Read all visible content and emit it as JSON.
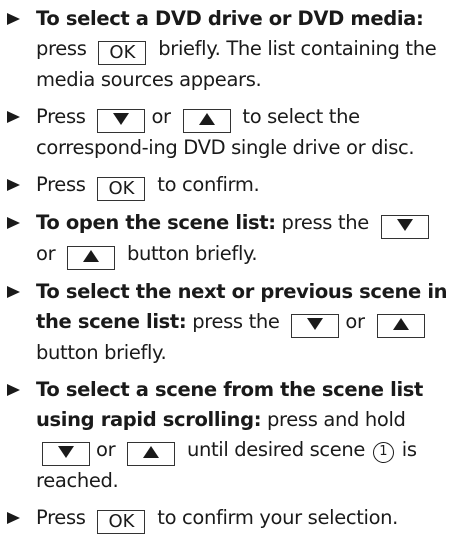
{
  "steps": [
    {
      "bold": "To select a DVD drive or DVD media:",
      "text_a": " press",
      "key": "OK",
      "text_b": " briefly. The list containing the media sources appears."
    },
    {
      "text_a": "Press",
      "text_or": "or",
      "text_b": " to select the correspond-ing DVD single drive or disc."
    },
    {
      "text_a": "Press",
      "key": "OK",
      "text_b": " to confirm."
    },
    {
      "bold": "To open the scene list:",
      "text_a": " press the",
      "text_or": "or",
      "text_b": " button briefly."
    },
    {
      "bold": "To select the next or previous scene in the scene list:",
      "text_a": " press the",
      "text_or": "or",
      "text_b": " button briefly."
    },
    {
      "bold": "To select a scene from the scene list using rapid scrolling:",
      "text_a": " press and hold",
      "text_or": "or",
      "text_b": " until desired scene",
      "marker": "1",
      "text_c": " is reached."
    },
    {
      "text_a": "Press",
      "key": "OK",
      "text_b": " to confirm your selection."
    }
  ],
  "icons": {
    "bullet": "right-arrow-bullet-icon",
    "down": "down-triangle-icon",
    "up": "up-triangle-icon"
  }
}
